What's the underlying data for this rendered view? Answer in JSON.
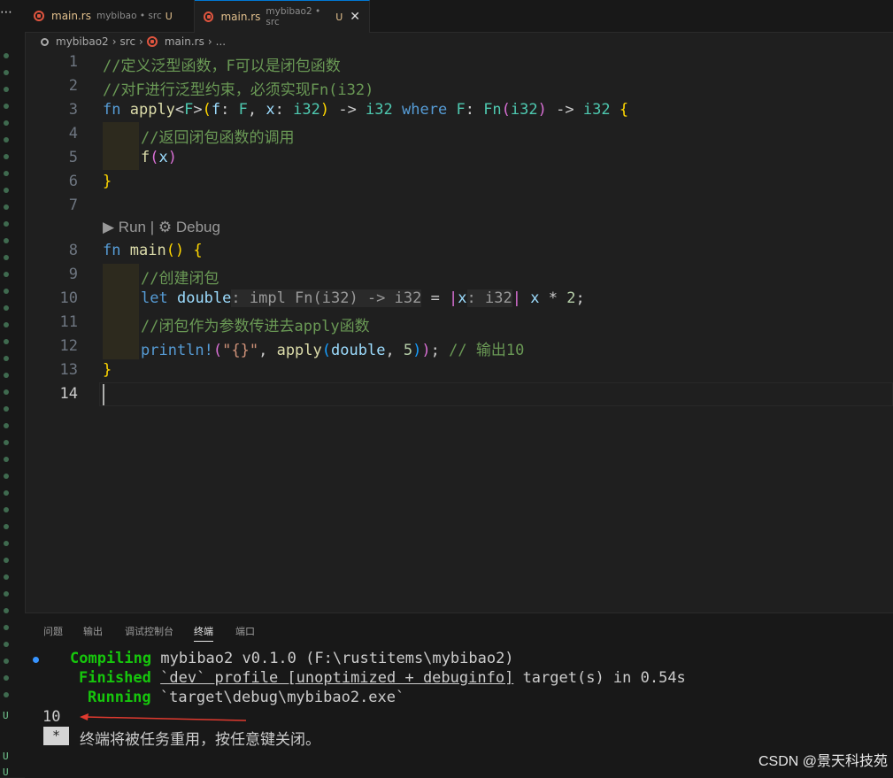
{
  "tabs": [
    {
      "name": "main.rs",
      "desc": "mybibao • src",
      "status": "U",
      "active": false
    },
    {
      "name": "main.rs",
      "desc": "mybibao2 • src",
      "status": "U",
      "active": true
    }
  ],
  "overflow_label": "⋯",
  "breadcrumb": [
    "mybibao2",
    "src",
    "main.rs",
    "..."
  ],
  "codelens": {
    "run": "Run",
    "sep": "|",
    "debug": "Debug"
  },
  "line_numbers": [
    "1",
    "2",
    "3",
    "4",
    "5",
    "6",
    "7",
    "8",
    "9",
    "10",
    "11",
    "12",
    "13",
    "14"
  ],
  "code": {
    "l1": "//定义泛型函数，F可以是闭包函数",
    "l2": "//对F进行泛型约束，必须实现Fn(i32)",
    "l4": "//返回闭包函数的调用",
    "l9": "//创建闭包",
    "l11": "//闭包作为参数传进去apply函数",
    "l12_comment": "// 输出10"
  },
  "panel_tabs": [
    "问题",
    "输出",
    "调试控制台",
    "终端",
    "端口"
  ],
  "active_panel_tab": "终端",
  "terminal": {
    "compiling_label": "Compiling",
    "compiling_text": "mybibao2 v0.1.0 (F:\\rustitems\\mybibao2)",
    "finished_label": "Finished",
    "finished_profile": "`dev` profile [unoptimized + debuginfo]",
    "finished_text": "target(s) in 0.54s",
    "running_label": "Running",
    "running_text": "`target\\debug\\mybibao2.exe`",
    "output": "10",
    "star": "*",
    "notice": "终端将被任务重用，按任意键关闭。"
  },
  "side_letters": [
    "U",
    "U",
    "U"
  ],
  "watermark": "CSDN @景天科技苑",
  "colors": {
    "accent": "#0078d4",
    "comment": "#6a9955",
    "keyword": "#569cd6",
    "arrow": "#e03a2f"
  }
}
